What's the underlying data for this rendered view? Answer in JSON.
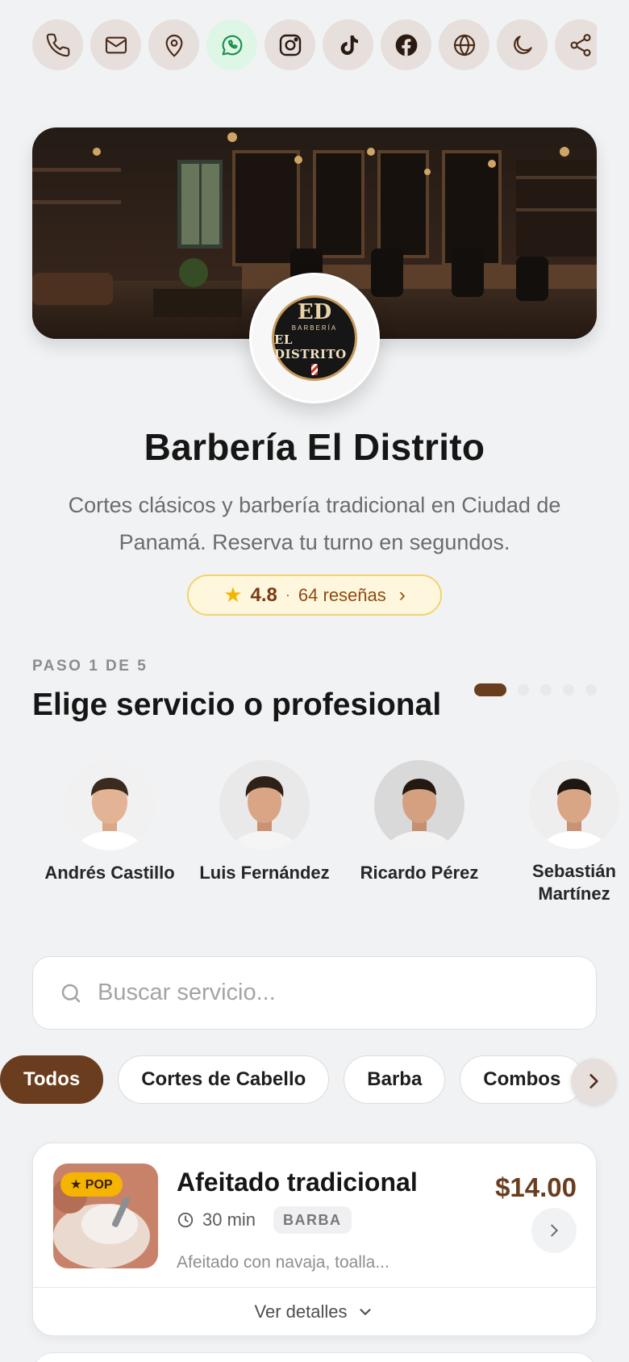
{
  "top_actions": [
    {
      "icon": "phone-icon"
    },
    {
      "icon": "mail-icon"
    },
    {
      "icon": "map-pin-icon"
    },
    {
      "icon": "whatsapp-icon"
    },
    {
      "icon": "instagram-icon"
    },
    {
      "icon": "tiktok-icon"
    },
    {
      "icon": "facebook-icon"
    },
    {
      "icon": "globe-icon"
    },
    {
      "icon": "moon-icon"
    },
    {
      "icon": "share-icon"
    }
  ],
  "brand": {
    "logo_monogram": "ED",
    "logo_small": "BARBERÍA",
    "logo_big": "EL DISTRITO",
    "title": "Barbería El Distrito",
    "description": "Cortes clásicos y barbería tradicional en Ciudad de Panamá. Reserva tu turno en segundos."
  },
  "rating": {
    "score": "4.8",
    "separator": "·",
    "reviews": "64 reseñas"
  },
  "step": {
    "label": "PASO 1 DE 5",
    "title": "Elige servicio o profesional",
    "current": 1,
    "total": 5
  },
  "professionals": [
    {
      "name": "Andrés Castillo"
    },
    {
      "name": "Luis Fernández"
    },
    {
      "name": "Ricardo Pérez"
    },
    {
      "name": "Sebastián Martínez"
    }
  ],
  "search": {
    "placeholder": "Buscar servicio..."
  },
  "categories": [
    "Todos",
    "Cortes de Cabello",
    "Barba",
    "Combos"
  ],
  "services": [
    {
      "badge": "★ POP",
      "name": "Afeitado tradicional",
      "price": "$14.00",
      "duration": "30 min",
      "tag": "BARBA",
      "description": "Afeitado con navaja, toalla...",
      "details_label": "Ver detalles"
    }
  ],
  "colors": {
    "accent": "#6b3d1f",
    "background": "#f1f2f4",
    "star": "#f5b400",
    "whatsapp_bg": "#def6e6"
  }
}
